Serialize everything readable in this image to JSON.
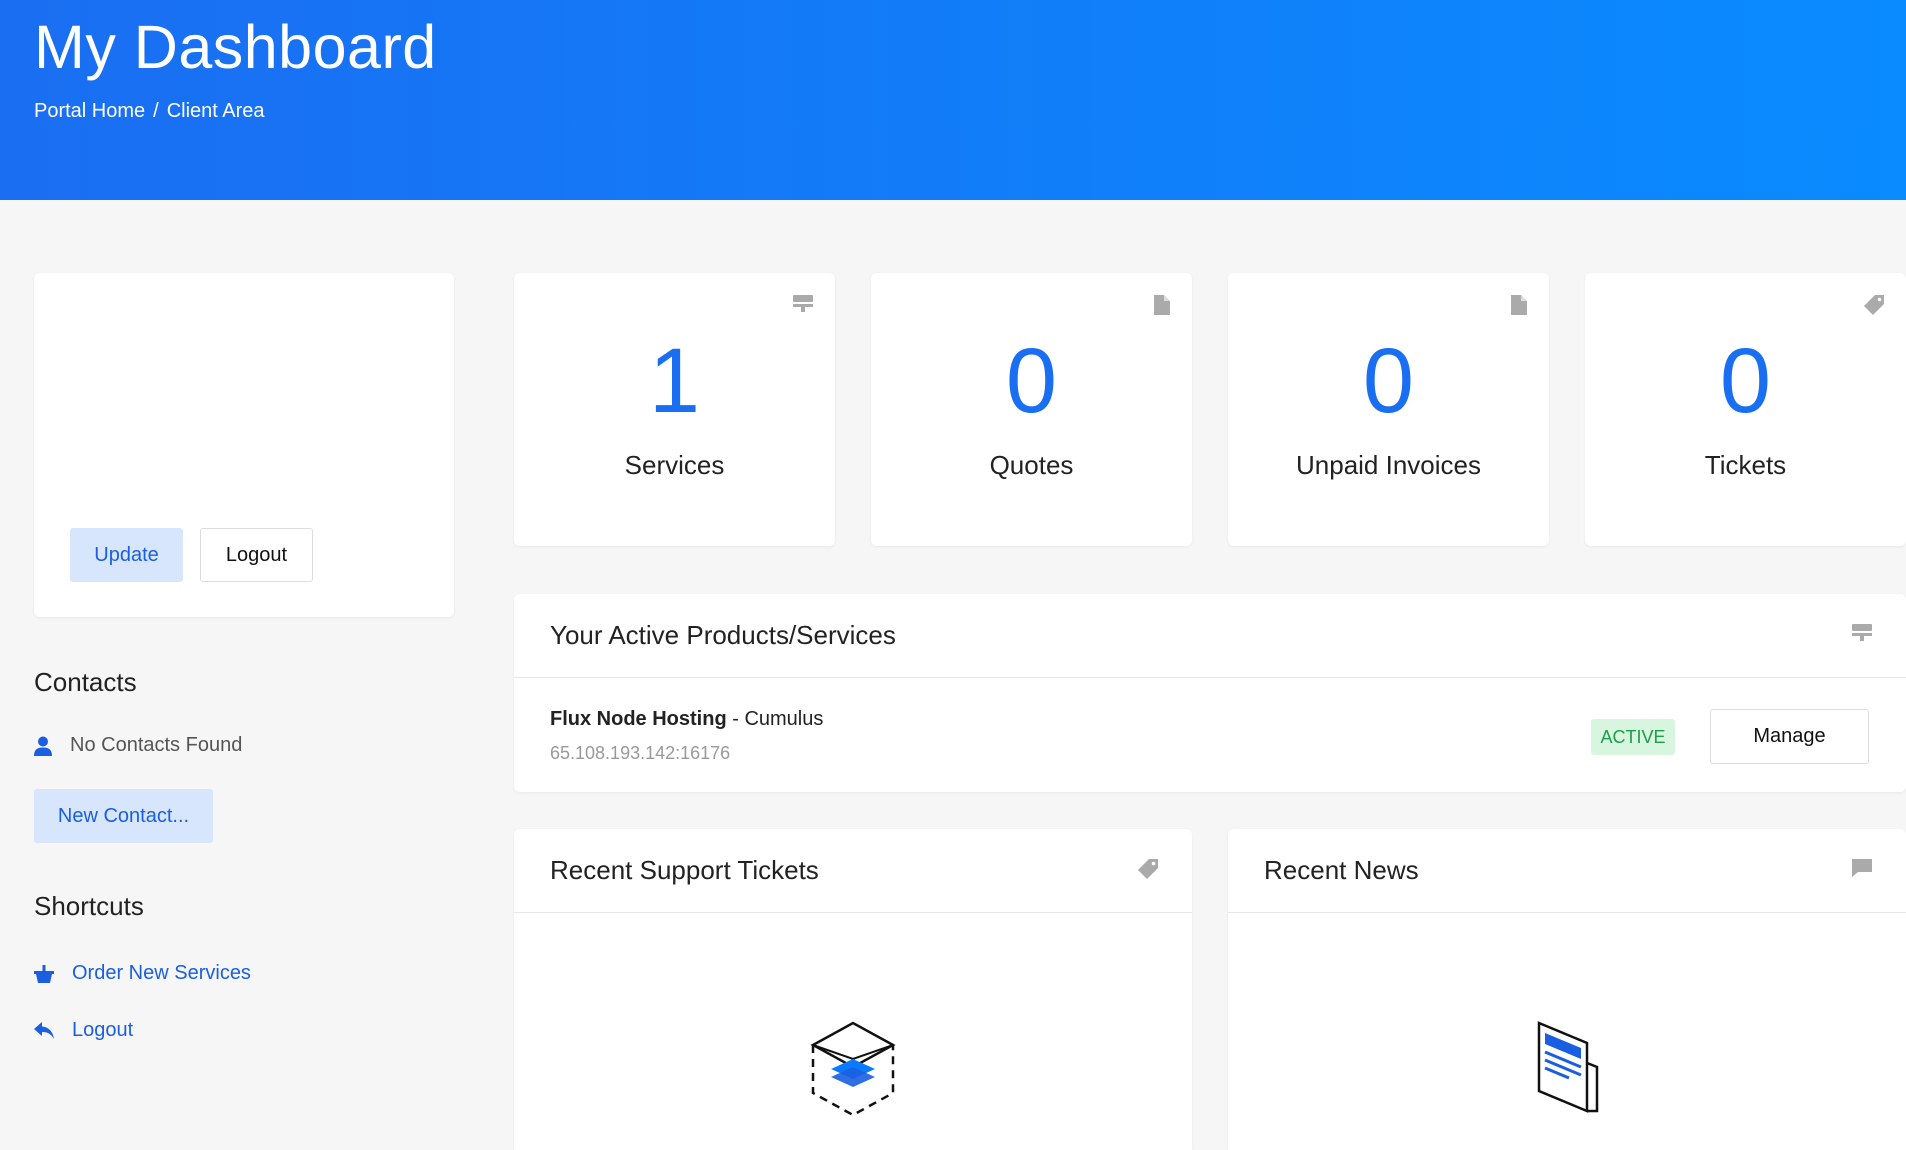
{
  "header": {
    "title": "My Dashboard",
    "breadcrumb": [
      "Portal Home",
      "Client Area"
    ],
    "breadcrumb_sep": "/"
  },
  "profile": {
    "update_label": "Update",
    "logout_label": "Logout"
  },
  "contacts": {
    "title": "Contacts",
    "empty_text": "No Contacts Found",
    "new_label": "New Contact..."
  },
  "shortcuts": {
    "title": "Shortcuts",
    "items": [
      {
        "label": "Order New Services",
        "icon": "basket-icon"
      },
      {
        "label": "Logout",
        "icon": "reply-arrow-icon"
      }
    ]
  },
  "stats": [
    {
      "value": "1",
      "label": "Services",
      "icon": "server-icon"
    },
    {
      "value": "0",
      "label": "Quotes",
      "icon": "document-icon"
    },
    {
      "value": "0",
      "label": "Unpaid Invoices",
      "icon": "document-icon"
    },
    {
      "value": "0",
      "label": "Tickets",
      "icon": "tag-icon"
    }
  ],
  "products": {
    "title": "Your Active Products/Services",
    "item": {
      "name": "Flux Node Hosting",
      "sep": " - ",
      "plan": "Cumulus",
      "address": "65.108.193.142:16176",
      "status": "ACTIVE",
      "manage_label": "Manage"
    }
  },
  "tickets_panel": {
    "title": "Recent Support Tickets",
    "icon": "tag-icon"
  },
  "news_panel": {
    "title": "Recent News",
    "icon": "comment-icon"
  },
  "colors": {
    "accent": "#1a6ef1",
    "hero_start": "#1a6ef1",
    "hero_end": "#0a8bff",
    "active_badge": "#d8f5e0"
  }
}
